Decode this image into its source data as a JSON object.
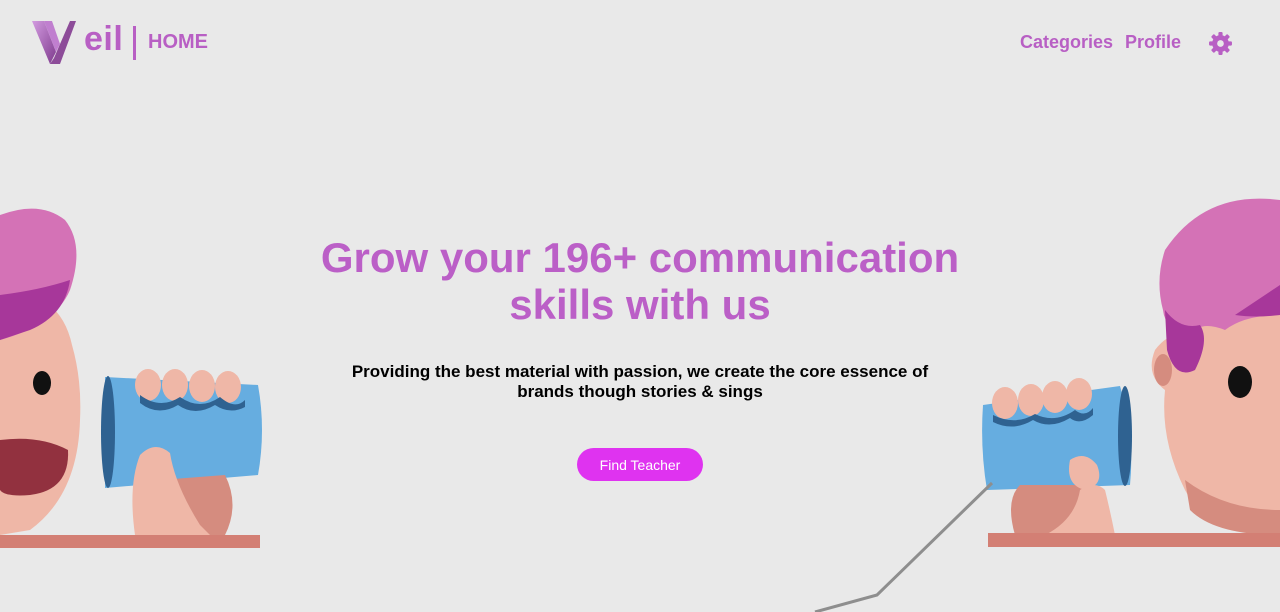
{
  "header": {
    "logo_letters": "eil",
    "page_label": "HOME",
    "nav": [
      "Categories",
      "Profile"
    ],
    "settings_icon": "gear-icon"
  },
  "hero": {
    "title_line1": "Grow your 196+ communication",
    "title_line2": "skills with us",
    "subtitle_line1": "Providing the best material with passion, we create the core essence of",
    "subtitle_line2": "brands though stories & sings",
    "cta_label": "Find Teacher"
  },
  "colors": {
    "brand": "#b85fc4",
    "cta": "#df33f0",
    "background": "#e9e9e9"
  }
}
